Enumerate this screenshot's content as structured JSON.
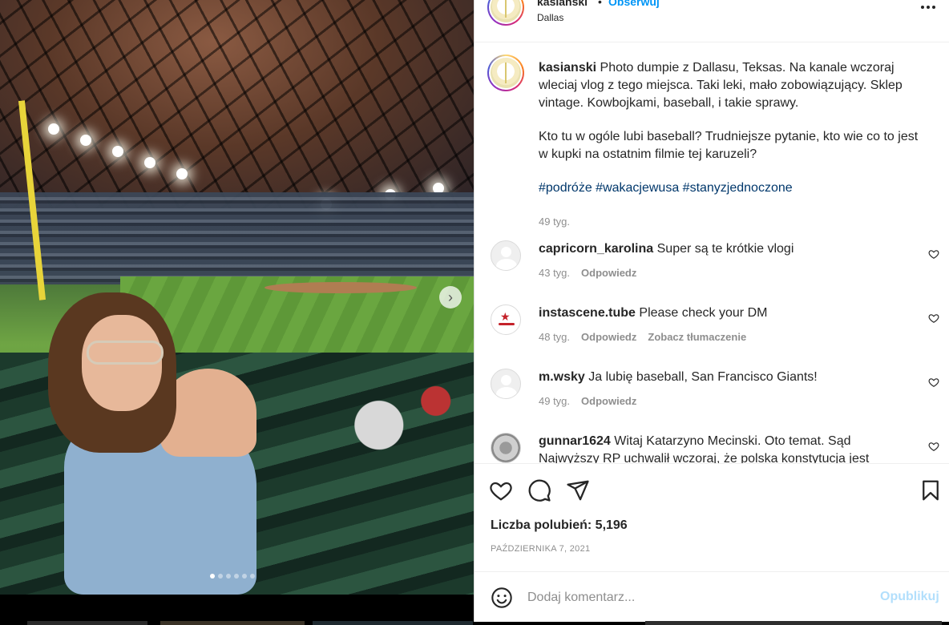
{
  "post": {
    "username": "kasianski",
    "separator": "•",
    "follow_label": "Obserwuj",
    "location": "Dallas",
    "carousel": {
      "total_slides": 6,
      "active_slide": 1
    }
  },
  "caption": {
    "username": "kasianski",
    "text_p1": "Photo dumpie z Dallasu, Teksas. Na kanale wczoraj wleciaj vlog z tego miejsca. Taki leki, mało zobowiązujący. Sklep vintage. Kowbojkami, baseball, i takie sprawy.",
    "text_p2": "Kto tu w ogóle lubi baseball? Trudniejsze pytanie, kto wie co to jest w kupki na ostatnim filmie tej karuzeli?",
    "hashtags": "#podróże #wakacjewusa #stanyzjednoczone",
    "time": "49 tyg."
  },
  "comments": [
    {
      "username": "capricorn_karolina",
      "text": "Super są te krótkie vlogi",
      "time": "43 tyg.",
      "reply": "Odpowiedz",
      "translate": ""
    },
    {
      "username": "instascene.tube",
      "text": "Please check your DM",
      "time": "48 tyg.",
      "reply": "Odpowiedz",
      "translate": "Zobacz tłumaczenie"
    },
    {
      "username": "m.wsky",
      "text": "Ja lubię baseball, San Francisco Giants!",
      "time": "49 tyg.",
      "reply": "Odpowiedz",
      "translate": ""
    },
    {
      "username": "gunnar1624",
      "text": "Witaj Katarzyno Mecinski. Oto temat. Sąd Najwyższy RP uchwalił wczoraj, że polska konstytucja jest",
      "time": "",
      "reply": "",
      "translate": ""
    }
  ],
  "actions": {
    "likes_label": "Liczba polubień: 5,196",
    "date": "PAŹDZIERNIKA 7, 2021"
  },
  "add_comment": {
    "placeholder": "Dodaj komentarz...",
    "publish_label": "Opublikuj"
  },
  "colors": {
    "link_blue": "#0095f6",
    "hashtag": "#00376b",
    "publish_disabled": "#b2dffc",
    "muted": "#8e8e8e"
  },
  "icons": [
    "more-icon",
    "heart-icon",
    "comment-icon",
    "share-icon",
    "bookmark-icon",
    "emoji-icon",
    "chevron-right-icon"
  ]
}
